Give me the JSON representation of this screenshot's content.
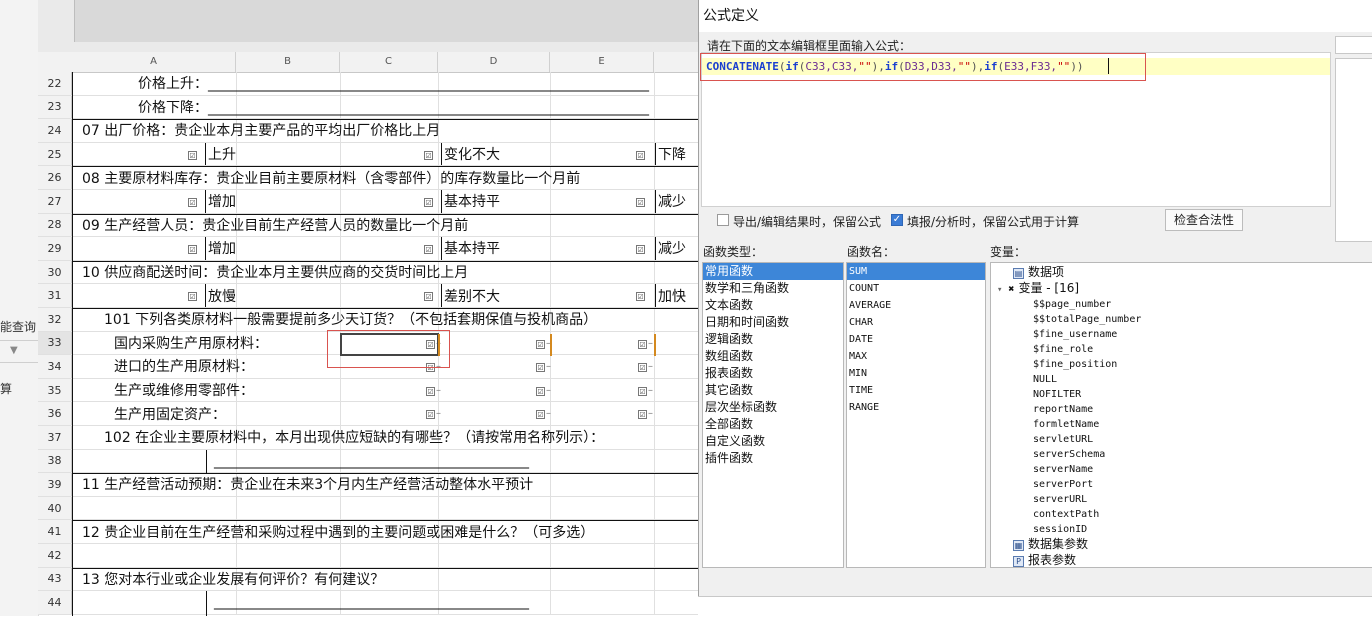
{
  "left_strip": {
    "labels": [
      "能查询",
      "算"
    ]
  },
  "sheet": {
    "column_headers": [
      "A",
      "B",
      "C",
      "D",
      "E"
    ],
    "rows": [
      {
        "num": "22",
        "text": "价格上升：_______________________________________________________________"
      },
      {
        "num": "23",
        "text": "价格下降：_______________________________________________________________"
      },
      {
        "num": "24",
        "text": "07 出厂价格：贵企业本月主要产品的平均出厂价格比上月"
      },
      {
        "num": "25",
        "opts": [
          "上升",
          "变化不大",
          "下降"
        ]
      },
      {
        "num": "26",
        "text": "08 主要原材料库存：贵企业目前主要原材料（含零部件）的库存数量比一个月前"
      },
      {
        "num": "27",
        "opts": [
          "增加",
          "基本持平",
          "减少"
        ]
      },
      {
        "num": "28",
        "text": "09 生产经营人员：贵企业目前生产经营人员的数量比一个月前"
      },
      {
        "num": "29",
        "opts": [
          "增加",
          "基本持平",
          "减少"
        ]
      },
      {
        "num": "30",
        "text": "10 供应商配送时间：贵企业本月主要供应商的交货时间比上月"
      },
      {
        "num": "31",
        "opts": [
          "放慢",
          "差别不大",
          "加快"
        ]
      },
      {
        "num": "32",
        "text": "101 下列各类原材料一般需要提前多少天订货？（不包括套期保值与投机商品）"
      },
      {
        "num": "33",
        "text": "国内采购生产用原材料："
      },
      {
        "num": "34",
        "text": "进口的生产用原材料："
      },
      {
        "num": "35",
        "text": "生产或维修用零部件："
      },
      {
        "num": "36",
        "text": "生产用固定资产："
      },
      {
        "num": "37",
        "text": "102 在企业主要原材料中，本月出现供应短缺的有哪些？（请按常用名称列示）："
      },
      {
        "num": "38",
        "text": "_____________________________________________"
      },
      {
        "num": "39",
        "text": "11 生产经营活动预期：贵企业在未来3个月内生产经营活动整体水平预计"
      },
      {
        "num": "40",
        "text": ""
      },
      {
        "num": "41",
        "text": "12 贵企业目前在生产经营和采购过程中遇到的主要问题或困难是什么？（可多选）"
      },
      {
        "num": "42",
        "text": ""
      },
      {
        "num": "43",
        "text": "13 您对本行业或企业发展有何评价？有何建议？"
      },
      {
        "num": "44",
        "text": "_____________________________________________"
      }
    ]
  },
  "dialog": {
    "title": "公式定义",
    "instruction": "请在下面的文本编辑框里面输入公式：",
    "formula_tokens": [
      {
        "t": "CONCATENATE",
        "c": "fn"
      },
      {
        "t": "(",
        "c": "pp"
      },
      {
        "t": "if",
        "c": "fn"
      },
      {
        "t": "(",
        "c": "pp"
      },
      {
        "t": "C33,C33,",
        "c": "ar"
      },
      {
        "t": "\"\"",
        "c": "st"
      },
      {
        "t": "),",
        "c": "pp"
      },
      {
        "t": "if",
        "c": "fn"
      },
      {
        "t": "(",
        "c": "pp"
      },
      {
        "t": "D33,D33,",
        "c": "ar"
      },
      {
        "t": "\"\"",
        "c": "st"
      },
      {
        "t": "),",
        "c": "pp"
      },
      {
        "t": "if",
        "c": "fn"
      },
      {
        "t": "(",
        "c": "pp"
      },
      {
        "t": "E33,F33,",
        "c": "ar"
      },
      {
        "t": "\"\"",
        "c": "st"
      },
      {
        "t": "))",
        "c": "pp"
      }
    ],
    "options": {
      "keep_formula_export": {
        "label": "导出/编辑结果时，保留公式",
        "checked": false
      },
      "keep_formula_calc": {
        "label": "填报/分析时，保留公式用于计算",
        "checked": true
      }
    },
    "validate_button": "检查合法性",
    "panels": {
      "categories_label": "函数类型：",
      "functions_label": "函数名：",
      "variables_label": "变量："
    },
    "categories": [
      "常用函数",
      "数学和三角函数",
      "文本函数",
      "日期和时间函数",
      "逻辑函数",
      "数组函数",
      "报表函数",
      "其它函数",
      "层次坐标函数",
      "全部函数",
      "自定义函数",
      "插件函数"
    ],
    "selected_category": "常用函数",
    "functions": [
      "SUM",
      "COUNT",
      "AVERAGE",
      "CHAR",
      "DATE",
      "MAX",
      "MIN",
      "TIME",
      "RANGE"
    ],
    "selected_function": "SUM",
    "variables": {
      "data_item": "数据项",
      "group_label": "变量 - [16]",
      "items": [
        "$$page_number",
        "$$totalPage_number",
        "$fine_username",
        "$fine_role",
        "$fine_position",
        "NULL",
        "NOFILTER",
        "reportName",
        "formletName",
        "servletURL",
        "serverSchema",
        "serverName",
        "serverPort",
        "serverURL",
        "contextPath",
        "sessionID"
      ],
      "dataset_params": "数据集参数",
      "report_params": "报表参数"
    }
  }
}
